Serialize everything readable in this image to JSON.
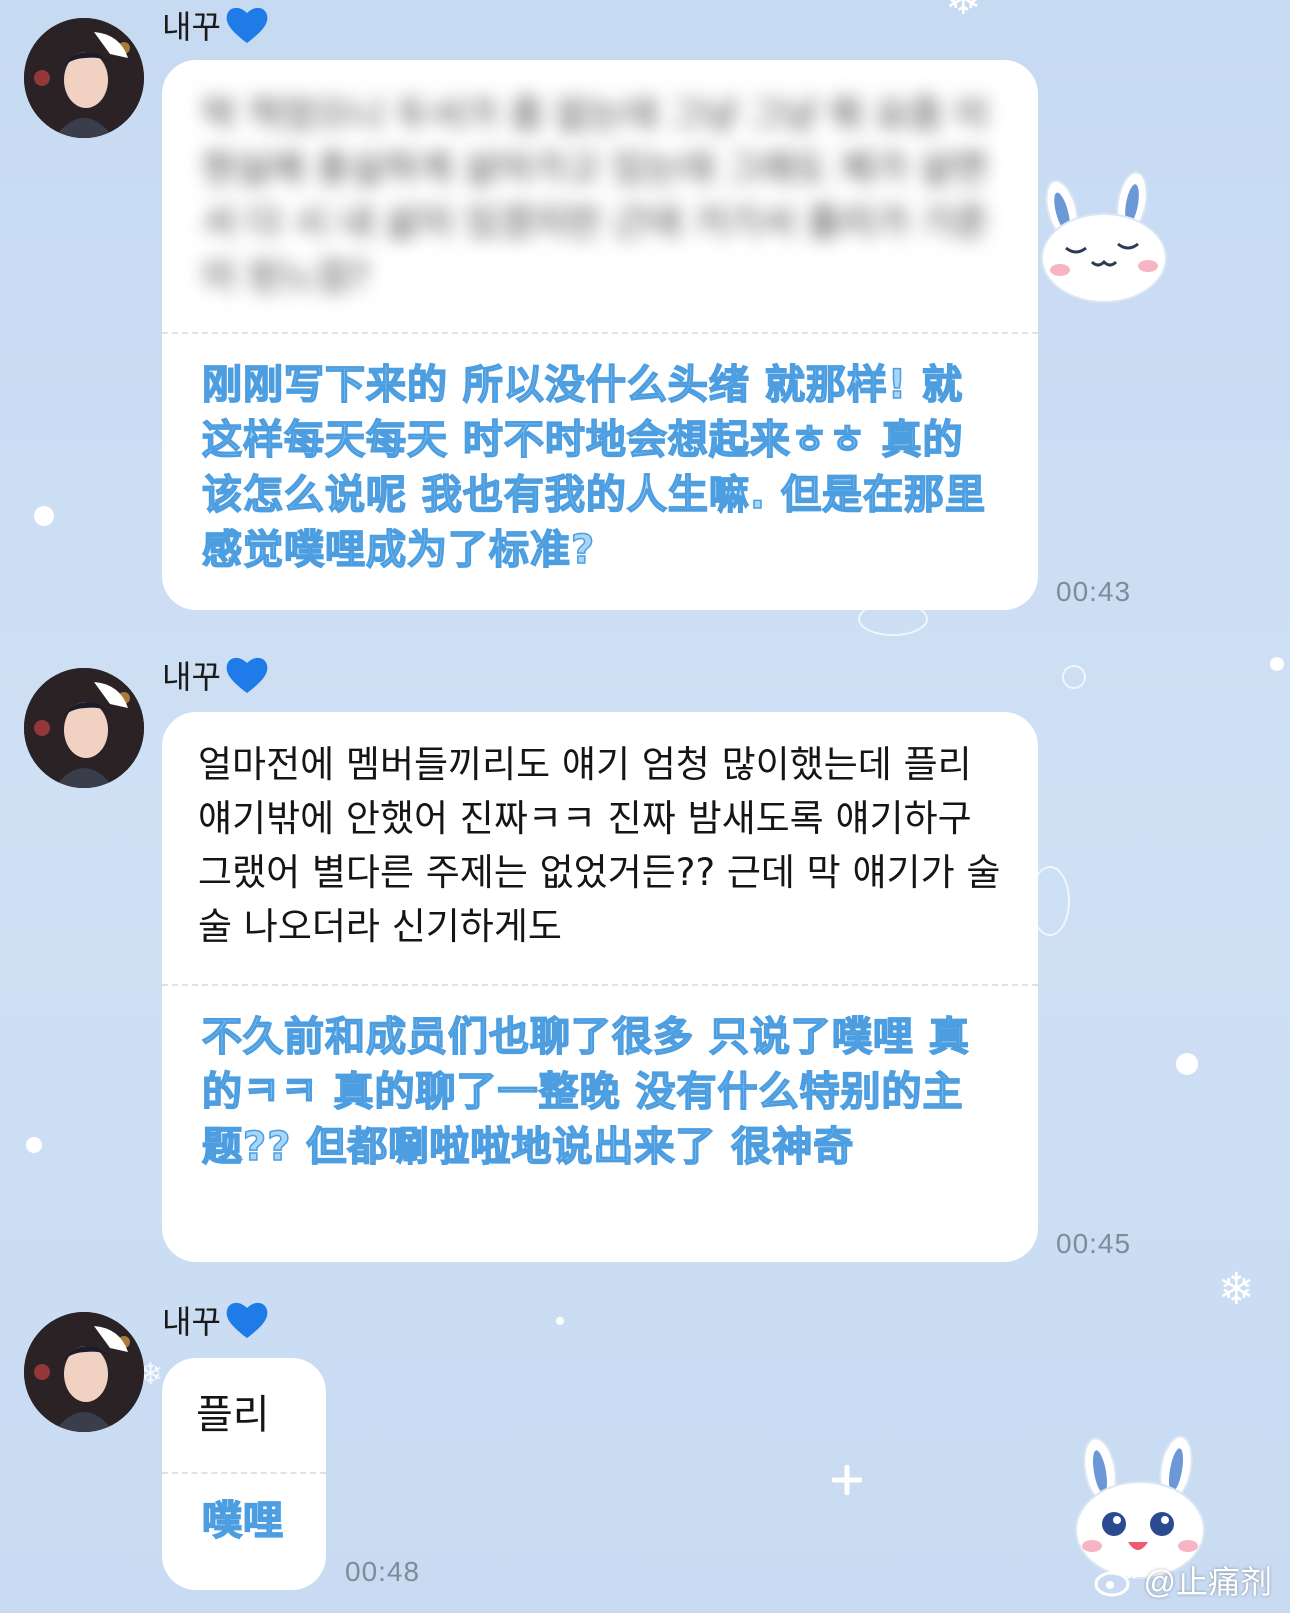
{
  "colors": {
    "background": "#c9dcf3",
    "bubble": "#ffffff",
    "translation_fill": "#a9d6f7",
    "translation_stroke": "#4c9ee0",
    "heart": "#1f7be8",
    "time": "#7f8c98"
  },
  "messages": [
    {
      "sender": "내꾸",
      "sender_icon": "blue-heart-icon",
      "original": "막 적었으니 두서가 좀 없는데 그냥 그냥 뭐 요즘 이 현실에 충실하게 살아가고 있는데 그래도 제가 살면서 다 시 내 삶이 있겠지만 근데 거기서 플리가 기준이 된느낌?",
      "original_blurred": true,
      "translation": "刚刚写下来的 所以没什么头绪 就那样! 就这样每天每天 时不时地会想起来ㅎㅎ 真的该怎么说呢 我也有我的人生嘛. 但是在那里感觉噗哩成为了标准?",
      "time": "00:43"
    },
    {
      "sender": "내꾸",
      "sender_icon": "blue-heart-icon",
      "original": "얼마전에 멤버들끼리도 얘기 엄청 많이했는데 플리 얘기밖에 안했어 진짜ㅋㅋ 진짜 밤새도록 얘기하구 그랬어 별다른 주제는 없었거든?? 근데 막 얘기가 술술 나오더라 신기하게도",
      "original_blurred": false,
      "translation": "不久前和成员们也聊了很多 只说了噗哩 真的ㅋㅋ 真的聊了一整晚 没有什么特别的主题?? 但都唰啦啦地说出来了 很神奇",
      "time": "00:45"
    },
    {
      "sender": "내꾸",
      "sender_icon": "blue-heart-icon",
      "original": "플리",
      "original_blurred": false,
      "translation": "噗哩",
      "time": "00:48"
    }
  ],
  "watermark": {
    "icon": "weibo-icon",
    "text": "@止痛剂"
  }
}
